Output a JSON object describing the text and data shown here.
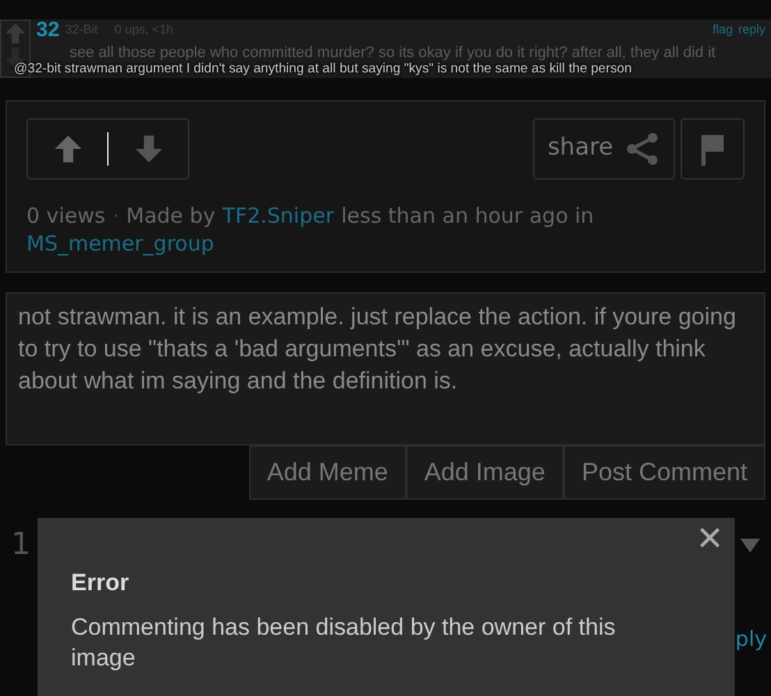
{
  "embedded_comment": {
    "author": "32-Bit",
    "avatar_text": "32",
    "meta": "0 ups, <1h",
    "links": [
      "flag",
      "reply"
    ],
    "text": "see all those people who committed murder? so its okay if you do it right? after all, they all did it",
    "caption": "@32-bit strawman argument I didn't say anything at all but saying \"kys\" is not the same as kill the person"
  },
  "image_panel": {
    "share_label": "share",
    "views": "0 views",
    "separator": "·",
    "made_by": "Made by",
    "author": "TF2.Sniper",
    "time": "less than an hour ago in",
    "group": "MS_memer_group"
  },
  "comment_field": {
    "value": "not strawman. it is an example. just replace the action. if youre going to try to use \"thats a 'bad arguments'\" as an excuse, actually think about what im saying and the definition is."
  },
  "comment_buttons": [
    "Add Meme",
    "Add Image",
    "Post Comment"
  ],
  "below": {
    "count": "1",
    "reply_partial": "ply"
  },
  "modal": {
    "close": "✕",
    "title": "Error",
    "message": "Commenting has been disabled by the owner of this image"
  }
}
